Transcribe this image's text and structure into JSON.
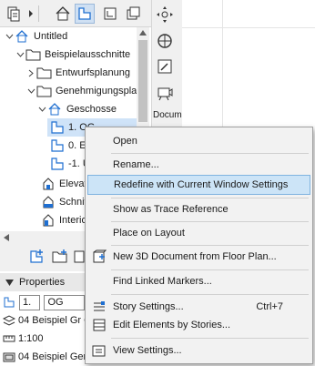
{
  "tree": {
    "root": "Untitled",
    "beispiel": "Beispielausschnitte",
    "entwurf": "Entwurfsplanung",
    "genehmigung": "Genehmigungsplan",
    "geschosse": "Geschosse",
    "og1": "1. OG",
    "eg": "0. E",
    "ug": "-1. U",
    "elev": "Elevat",
    "schnitt": "Schnit",
    "interior": "Interio"
  },
  "right_panel": {
    "docu_label": "Docum"
  },
  "properties": {
    "header": "Properties",
    "story_number": "1.",
    "story_name": "OG",
    "row1": "04 Beispiel Gr G",
    "row2": "1:100",
    "row3": "04 Beispiel Gene"
  },
  "context_menu": {
    "open": "Open",
    "rename": "Rename...",
    "redefine": "Redefine with Current Window Settings",
    "trace": "Show as Trace Reference",
    "place_layout": "Place on Layout",
    "new_3d": "New 3D Document from Floor Plan...",
    "find_markers": "Find Linked Markers...",
    "story_settings": "Story Settings...",
    "story_settings_shortcut": "Ctrl+7",
    "edit_elements": "Edit Elements by Stories...",
    "view_settings": "View Settings..."
  },
  "colors": {
    "accent": "#1f6fd1",
    "highlight": "#cce4f7",
    "menu_bg": "#f2f2f2"
  }
}
